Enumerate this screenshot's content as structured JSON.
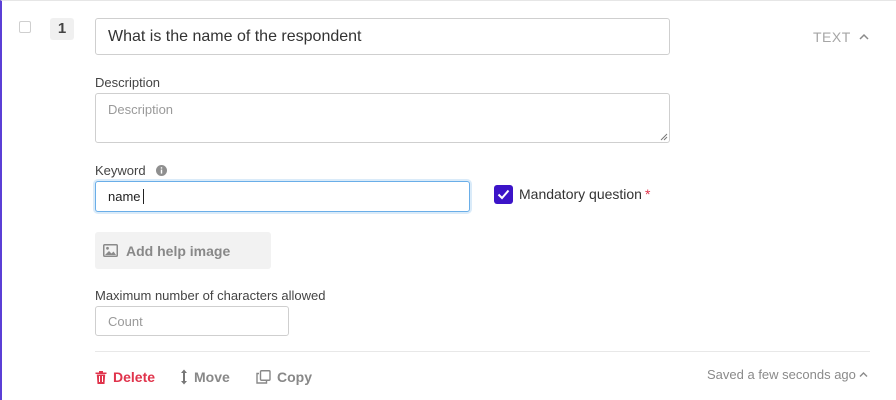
{
  "question": {
    "number": "1",
    "title": "What is the name of the respondent",
    "type_label": "TEXT"
  },
  "description": {
    "label": "Description",
    "placeholder": "Description",
    "value": ""
  },
  "keyword": {
    "label": "Keyword",
    "value": "name"
  },
  "mandatory": {
    "label": "Mandatory question",
    "asterisk": "*",
    "checked": true
  },
  "help_image": {
    "label": "Add help image",
    "icon": "image-icon"
  },
  "max_chars": {
    "label": "Maximum number of characters allowed",
    "placeholder": "Count",
    "value": ""
  },
  "footer": {
    "delete_label": "Delete",
    "move_label": "Move",
    "copy_label": "Copy",
    "saved_status": "Saved a few seconds ago"
  },
  "colors": {
    "accent": "#3c14c8",
    "delete": "#e0344c",
    "focus_border": "#6aaee8",
    "muted_text": "#888888"
  }
}
